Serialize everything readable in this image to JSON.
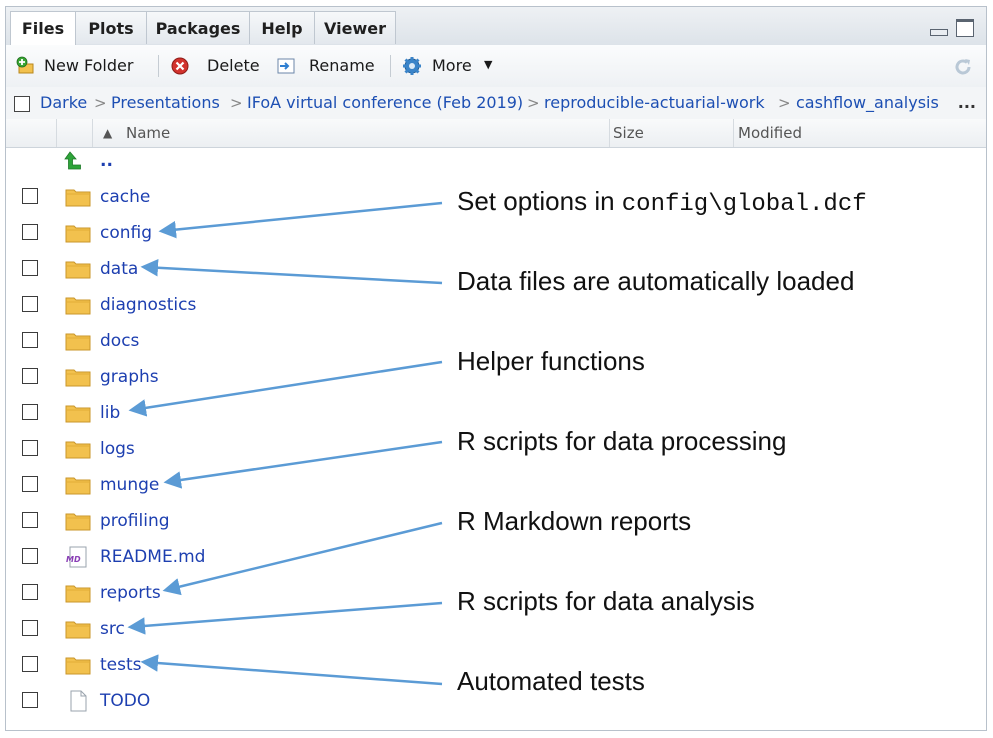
{
  "tabs": [
    "Files",
    "Plots",
    "Packages",
    "Help",
    "Viewer"
  ],
  "toolbar": {
    "new_folder": "New Folder",
    "delete": "Delete",
    "rename": "Rename",
    "more": "More"
  },
  "breadcrumb": {
    "items": [
      "Darke",
      "Presentations",
      "IFoA virtual conference (Feb 2019)",
      "reproducible-actuarial-work",
      "cashflow_analysis"
    ],
    "separator": ">",
    "more": "..."
  },
  "columns": {
    "name": "Name",
    "size": "Size",
    "modified": "Modified",
    "sort_indicator": "▲"
  },
  "parent_dir": "..",
  "files": [
    {
      "name": "cache",
      "type": "folder"
    },
    {
      "name": "config",
      "type": "folder"
    },
    {
      "name": "data",
      "type": "folder"
    },
    {
      "name": "diagnostics",
      "type": "folder"
    },
    {
      "name": "docs",
      "type": "folder"
    },
    {
      "name": "graphs",
      "type": "folder"
    },
    {
      "name": "lib",
      "type": "folder"
    },
    {
      "name": "logs",
      "type": "folder"
    },
    {
      "name": "munge",
      "type": "folder"
    },
    {
      "name": "profiling",
      "type": "folder"
    },
    {
      "name": "README.md",
      "type": "markdown"
    },
    {
      "name": "reports",
      "type": "folder"
    },
    {
      "name": "src",
      "type": "folder"
    },
    {
      "name": "tests",
      "type": "folder"
    },
    {
      "name": "TODO",
      "type": "file"
    }
  ],
  "annotations": {
    "config_prefix": "Set options in ",
    "config_code": "config\\global.dcf",
    "data": "Data files are automatically loaded",
    "lib": "Helper functions",
    "munge": "R scripts for data processing",
    "reports": "R Markdown reports",
    "src": "R scripts for data analysis",
    "tests": "Automated tests"
  },
  "colors": {
    "link": "#1d3fb0",
    "arrow": "#5b9bd5",
    "folder": "#f2c14e"
  }
}
